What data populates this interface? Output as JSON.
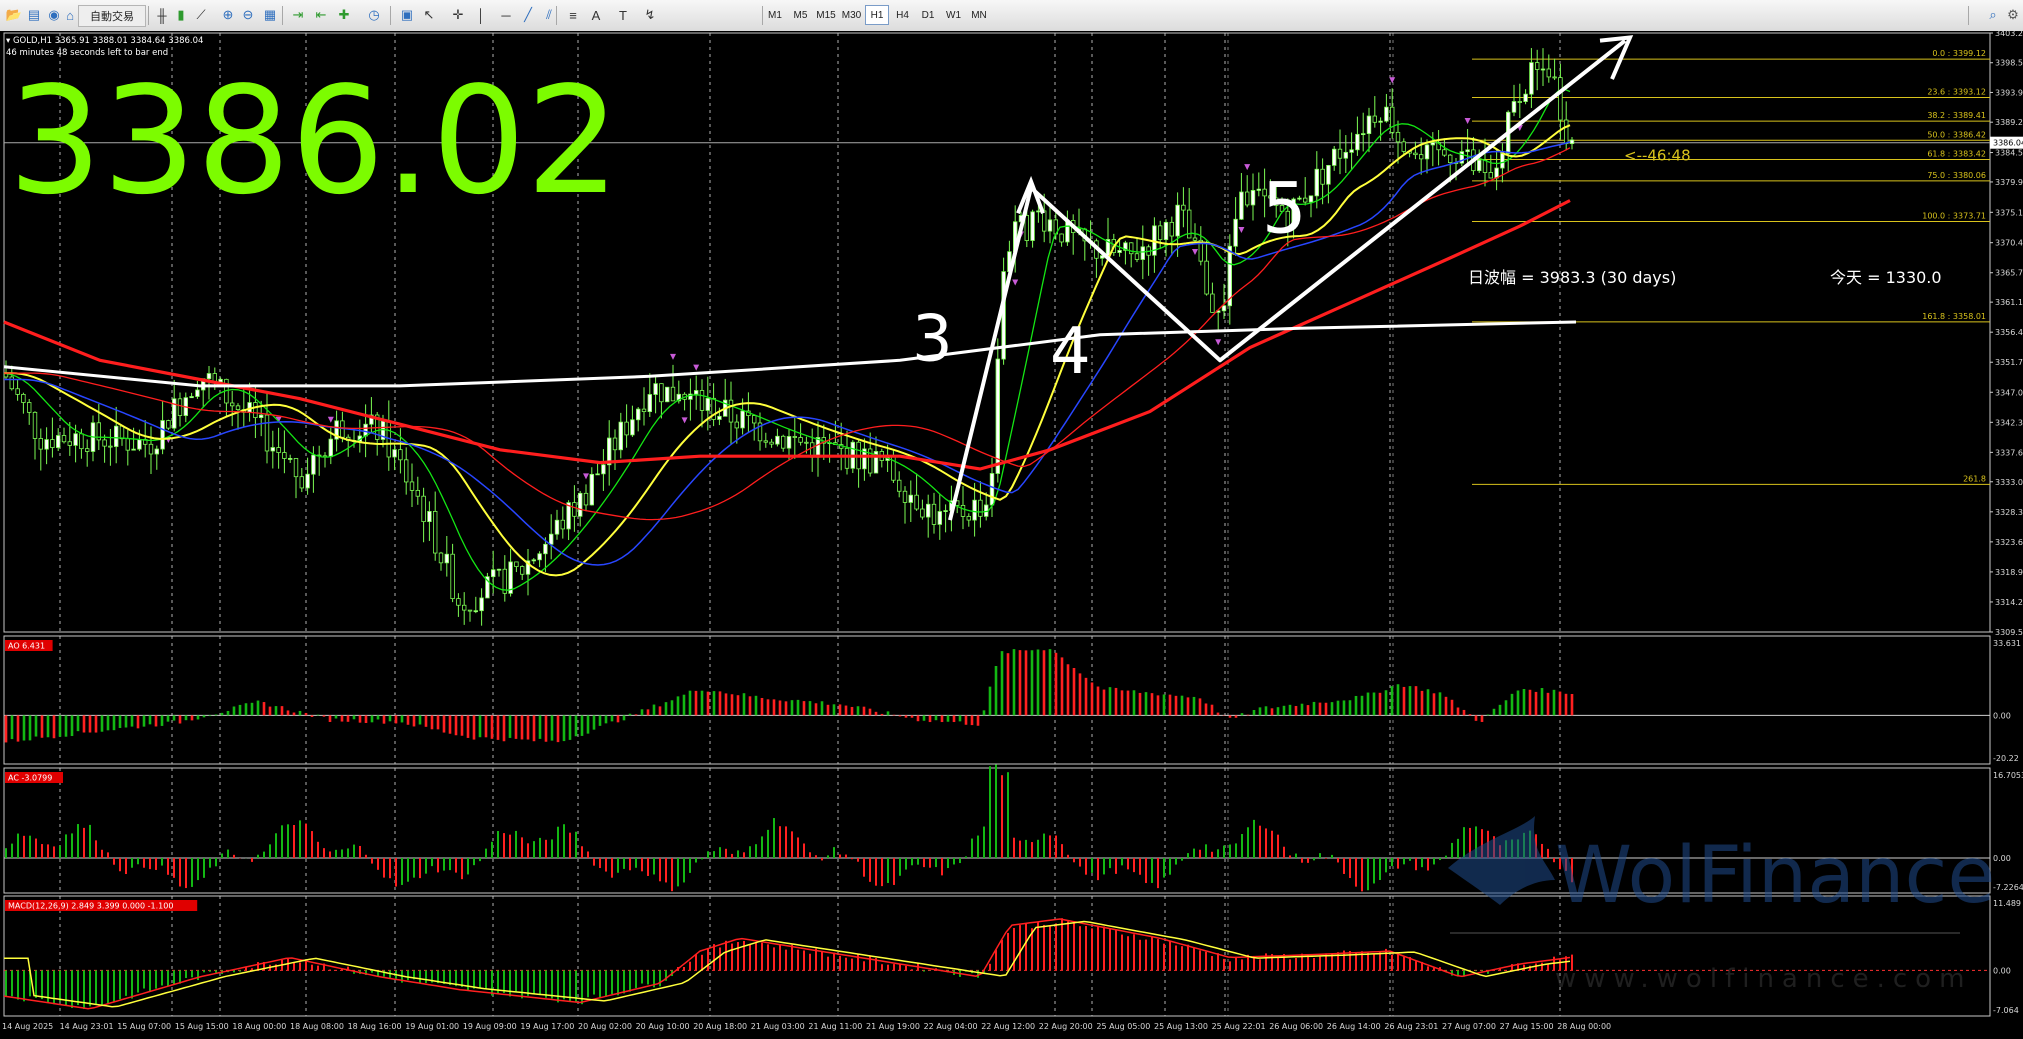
{
  "toolbar": {
    "autotrade_label": "自動交易",
    "timeframes": [
      "M1",
      "M5",
      "M15",
      "M30",
      "H1",
      "H4",
      "D1",
      "W1",
      "MN"
    ],
    "active_timeframe": "H1",
    "icons": [
      "open-folder-icon",
      "profiles-icon",
      "market-watch-icon",
      "navigator-icon",
      "terminal-icon",
      "autotrade-icon",
      "bar-chart-icon",
      "candles-icon",
      "line-chart-icon",
      "zoom-in-icon",
      "zoom-out-icon",
      "tile-icon",
      "autoscroll-icon",
      "chart-shift-icon",
      "indicators-icon",
      "periods-icon",
      "templates-icon",
      "cursor-icon",
      "crosshair-icon",
      "vertical-line-icon",
      "horizontal-line-icon",
      "trendline-icon",
      "channel-icon",
      "fibonacci-icon",
      "text-icon",
      "text-label-icon",
      "arrows-icon",
      "search-icon",
      "settings-icon"
    ]
  },
  "chart": {
    "symbol_line": "GOLD,H1  3365.91 3388.01 3384.64 3386.04",
    "bar_timer": "46 minutes 48 seconds left to bar end",
    "big_price": "3386.02",
    "countdown": "<--46:48",
    "range_text": "日波幅 = 3983.3  (30 days)",
    "today_text": "今天 = 1330.0",
    "wave_labels": [
      "3",
      "4",
      "5"
    ],
    "price_badge": "3386.04",
    "price_axis": [
      "3403.20",
      "3398.55",
      "3393.90",
      "3389.25",
      "3384.50",
      "3379.90",
      "3375.15",
      "3370.40",
      "3365.70",
      "3361.10",
      "3356.40",
      "3351.70",
      "3347.00",
      "3342.30",
      "3337.60",
      "3333.00",
      "3328.30",
      "3323.60",
      "3318.90",
      "3314.20",
      "3309.50"
    ],
    "fib_levels": [
      {
        "label": "0.0 : 3399.12",
        "price": 3399.12
      },
      {
        "label": "23.6 : 3393.12",
        "price": 3393.12
      },
      {
        "label": "38.2 : 3389.41",
        "price": 3389.41
      },
      {
        "label": "50.0 : 3386.42",
        "price": 3386.42
      },
      {
        "label": "61.8 : 3383.42",
        "price": 3383.42
      },
      {
        "label": "75.0 : 3380.06",
        "price": 3380.06
      },
      {
        "label": "100.0 : 3373.71",
        "price": 3373.71
      },
      {
        "label": "161.8 : 3358.01",
        "price": 3358.01
      },
      {
        "label": "261.8",
        "price": 3332.6
      }
    ],
    "time_axis": [
      "14 Aug 2025",
      "14 Aug 23:01",
      "15 Aug 07:00",
      "15 Aug 15:00",
      "18 Aug 00:00",
      "18 Aug 08:00",
      "18 Aug 16:00",
      "19 Aug 01:00",
      "19 Aug 09:00",
      "19 Aug 17:00",
      "20 Aug 02:00",
      "20 Aug 10:00",
      "20 Aug 18:00",
      "21 Aug 03:00",
      "21 Aug 11:00",
      "21 Aug 19:00",
      "22 Aug 04:00",
      "22 Aug 12:00",
      "22 Aug 20:00",
      "25 Aug 05:00",
      "25 Aug 13:00",
      "25 Aug 22:01",
      "26 Aug 06:00",
      "26 Aug 14:00",
      "26 Aug 23:01",
      "27 Aug 07:00",
      "27 Aug 15:00",
      "28 Aug 00:00"
    ],
    "watermark": "WolFinance",
    "watermark_url": "www.wolfinance.com"
  },
  "indicators": {
    "ao": {
      "label": "AO 6.431",
      "axis": [
        "33.631",
        "0.00",
        "-20.22"
      ]
    },
    "ac": {
      "label": "AC -3.0799",
      "axis": [
        "16.7053",
        "0.00",
        "-7.2264"
      ]
    },
    "macd": {
      "label": "MACD(12,26,9) 2.849 3.399 0.000 -1.100",
      "axis": [
        "11.489",
        "0.00",
        "-7.064"
      ]
    }
  },
  "colors": {
    "bull": "#7dfc54",
    "bear": "#ff2222",
    "ma_red": "#ff1e1e",
    "ma_yellow": "#ffff3c",
    "ma_green": "#14e614",
    "ma_blue": "#2846ff",
    "fib": "#d8c21c",
    "big_price": "#7cfc00",
    "fractal": "#c85ad7"
  }
}
